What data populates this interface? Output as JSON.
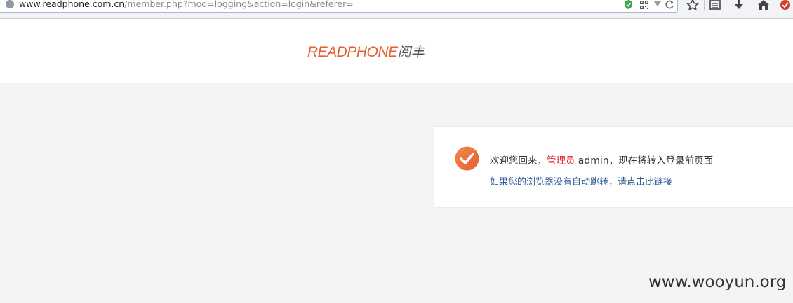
{
  "browser": {
    "url_host": "www.readphone.com.cn",
    "url_path": "/member.php?mod=logging&action=login&referer="
  },
  "header": {
    "logo_en": "READPHONE",
    "logo_cn": "阅丰"
  },
  "message": {
    "prefix": "欢迎您回来，",
    "role": "管理员",
    "username": "admin",
    "suffix": "，现在将转入登录前页面",
    "redirect_link": "如果您的浏览器没有自动跳转，请点击此链接"
  },
  "colors": {
    "accent": "#e5602f",
    "role": "#e5252e",
    "link": "#2f5b96",
    "background": "#f4f4f2"
  },
  "watermark": "www.wooyun.org"
}
